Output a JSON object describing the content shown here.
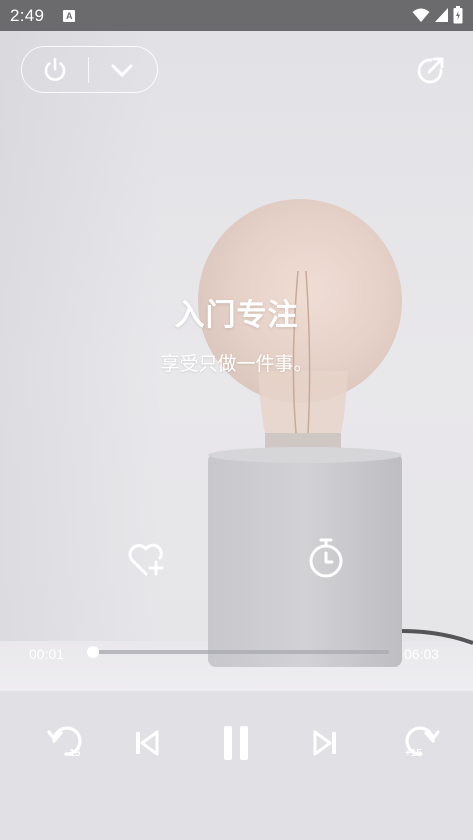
{
  "status_bar": {
    "time": "2:49",
    "notification_icon": "a-box-icon",
    "icons": [
      "wifi-icon",
      "signal-icon",
      "battery-icon"
    ]
  },
  "top_bar": {
    "power_icon": "power-icon",
    "collapse_icon": "chevron-down-icon",
    "share_icon": "share-icon"
  },
  "track": {
    "title": "入门专注",
    "subtitle": "享受只做一件事。"
  },
  "actions": {
    "favorite_icon": "heart-plus-icon",
    "timer_icon": "timer-icon"
  },
  "progress": {
    "current": "00:01",
    "total": "06:03",
    "fraction": 0.003
  },
  "controls": {
    "rewind_label": "-15",
    "forward_label": "+15",
    "icons": [
      "rewind-15-icon",
      "skip-previous-icon",
      "pause-icon",
      "skip-next-icon",
      "forward-15-icon"
    ]
  },
  "colors": {
    "accent": "#ffffff",
    "status_bar_bg": "#6b6b6d",
    "background": "#e4e4e8"
  }
}
